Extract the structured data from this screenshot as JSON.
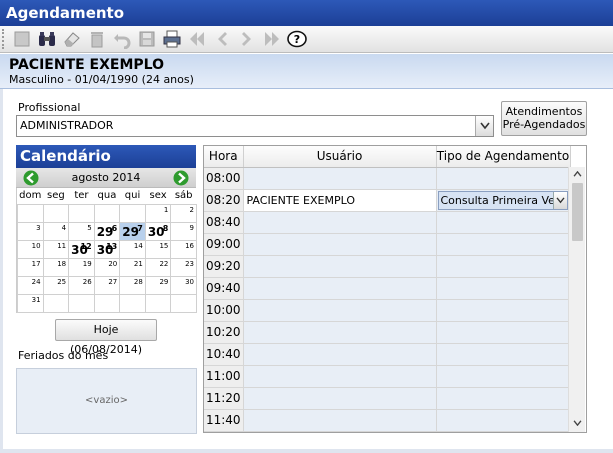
{
  "window": {
    "title": "Agendamento"
  },
  "toolbar": {
    "icons": [
      "new-icon",
      "find-icon",
      "eraser-icon",
      "trash-icon",
      "undo-icon",
      "save-icon",
      "print-icon",
      "first-icon",
      "prev-icon",
      "next-icon",
      "last-icon",
      "help-icon"
    ],
    "help_glyph": "?"
  },
  "patient": {
    "name": "PACIENTE EXEMPLO",
    "details": "Masculino - 01/04/1990 (24 anos)"
  },
  "profissional": {
    "label": "Profissional",
    "value": "ADMINISTRADOR"
  },
  "pre_agendados_button": {
    "line1": "Atendimentos",
    "line2": "Pré-Agendados"
  },
  "calendar": {
    "title": "Calendário",
    "month": "agosto 2014",
    "weekdays": [
      "dom",
      "seg",
      "ter",
      "qua",
      "qui",
      "sex",
      "sáb"
    ],
    "weeks": [
      [
        "",
        "",
        "",
        "",
        "",
        "1",
        "2"
      ],
      [
        "3",
        "4",
        "5",
        "6",
        "7",
        "8",
        "9"
      ],
      [
        "10",
        "11",
        "12",
        "13",
        "14",
        "15",
        "16"
      ],
      [
        "17",
        "18",
        "19",
        "20",
        "21",
        "22",
        "23"
      ],
      [
        "24",
        "25",
        "26",
        "27",
        "28",
        "29",
        "30"
      ],
      [
        "31",
        "",
        "",
        "",
        "",
        "",
        ""
      ]
    ],
    "marks": {
      "w1d3": "29",
      "w1d4": "29",
      "w1d5": "30",
      "w2d2": "30",
      "w2d3": "30"
    },
    "today_button": "Hoje (06/08/2014)",
    "accent": "#1f4aa8",
    "today_highlight": "#b8d0ec"
  },
  "feriados": {
    "label": "Feriados do mês",
    "empty": "<vazio>"
  },
  "schedule": {
    "headers": {
      "hora": "Hora",
      "usuario": "Usuário",
      "tipo": "Tipo de Agendamento"
    },
    "rows": [
      {
        "hora": "08:00",
        "usuario": "",
        "tipo": ""
      },
      {
        "hora": "08:20",
        "usuario": "PACIENTE EXEMPLO",
        "tipo": "Consulta Primeira Vez"
      },
      {
        "hora": "08:40",
        "usuario": "",
        "tipo": ""
      },
      {
        "hora": "09:00",
        "usuario": "",
        "tipo": ""
      },
      {
        "hora": "09:20",
        "usuario": "",
        "tipo": ""
      },
      {
        "hora": "09:40",
        "usuario": "",
        "tipo": ""
      },
      {
        "hora": "10:00",
        "usuario": "",
        "tipo": ""
      },
      {
        "hora": "10:20",
        "usuario": "",
        "tipo": ""
      },
      {
        "hora": "10:40",
        "usuario": "",
        "tipo": ""
      },
      {
        "hora": "11:00",
        "usuario": "",
        "tipo": ""
      },
      {
        "hora": "11:20",
        "usuario": "",
        "tipo": ""
      },
      {
        "hora": "11:40",
        "usuario": "",
        "tipo": ""
      }
    ]
  }
}
